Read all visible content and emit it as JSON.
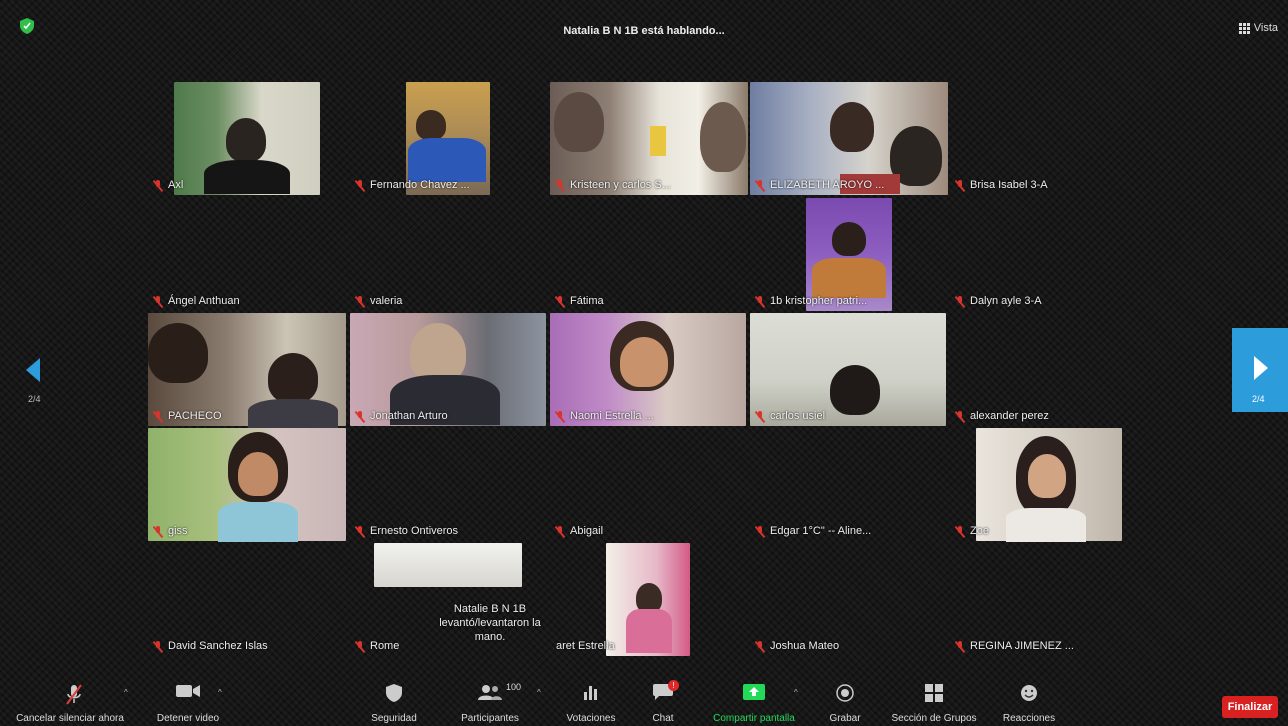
{
  "header": {
    "speaking_text": "Natalia B N 1B está hablando...",
    "view_label": "Vista"
  },
  "participants": [
    {
      "name": "Axl",
      "video": true
    },
    {
      "name": "Fernando Chavez ...",
      "video": true
    },
    {
      "name": "Kristeen y carlos S...",
      "video": true
    },
    {
      "name": "ELIZABETH AROYO ...",
      "video": true
    },
    {
      "name": "Brisa Isabel 3-A",
      "video": false
    },
    {
      "name": "Ángel Anthuan",
      "video": false
    },
    {
      "name": "valeria",
      "video": false
    },
    {
      "name": "Fátima",
      "video": false
    },
    {
      "name": "1b kristopher patri...",
      "video": true
    },
    {
      "name": "Dalyn ayle 3-A",
      "video": false
    },
    {
      "name": "PACHECO",
      "video": true
    },
    {
      "name": "Jonathan Arturo",
      "video": true
    },
    {
      "name": "Naomi Estrella ...",
      "video": true
    },
    {
      "name": "carlos usiel",
      "video": true
    },
    {
      "name": "alexander perez",
      "video": false
    },
    {
      "name": "giss",
      "video": true
    },
    {
      "name": "Ernesto Ontiveros",
      "video": false
    },
    {
      "name": "Abigail",
      "video": false
    },
    {
      "name": "Edgar 1°C\" -- Aline...",
      "video": false
    },
    {
      "name": "Zoe",
      "video": true
    },
    {
      "name": "David Sanchez Islas",
      "video": false
    },
    {
      "name": "Rome",
      "video": true
    },
    {
      "name": "aret Estrella",
      "video": true
    },
    {
      "name": "Joshua Mateo",
      "video": false
    },
    {
      "name": "REGINA JIMENEZ ...",
      "video": false
    }
  ],
  "raise_hand_note": "Natalie B N 1B levantó/levantaron la mano.",
  "pagination": {
    "left": "2/4",
    "right": "2/4"
  },
  "toolbar": {
    "mute": "Cancelar silenciar ahora",
    "video": "Detener video",
    "security": "Seguridad",
    "participants": "Participantes",
    "participants_count": "100",
    "polls": "Votaciones",
    "chat": "Chat",
    "chat_badge": "!",
    "share": "Compartir pantalla",
    "record": "Grabar",
    "breakout": "Sección de Grupos",
    "reactions": "Reacciones",
    "end": "Finalizar"
  },
  "colors": {
    "accent": "#2d9cdb",
    "end": "#d92121",
    "share": "#23d959",
    "muted": "#d8342e"
  }
}
